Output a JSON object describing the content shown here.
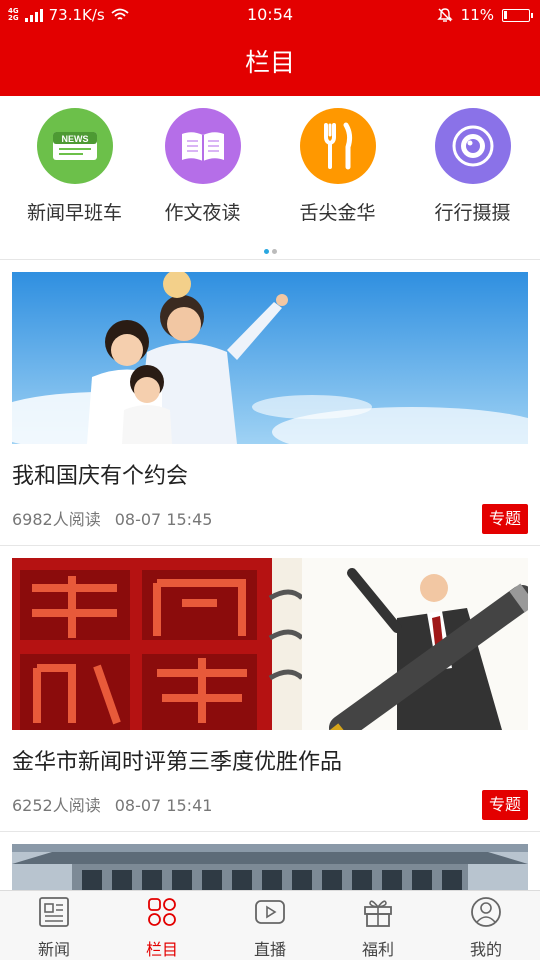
{
  "status_bar": {
    "network_top": "4G",
    "network_bottom": "2G",
    "speed": "73.1K/s",
    "time": "10:54",
    "battery": "11%",
    "battery_fraction": 0.11
  },
  "header": {
    "title": "栏目"
  },
  "columns": {
    "items": [
      {
        "label": "新闻早班车",
        "icon": "news-icon",
        "color": "#6cc04a"
      },
      {
        "label": "作文夜读",
        "icon": "book-icon",
        "color": "#b56ee8"
      },
      {
        "label": "舌尖金华",
        "icon": "fork-knife-icon",
        "color": "#ff9800"
      },
      {
        "label": "行行摄摄",
        "icon": "camera-lens-icon",
        "color": "#8a72e8"
      }
    ],
    "page_count": 2,
    "active_page": 1
  },
  "news": [
    {
      "title": "我和国庆有个约会",
      "reads": "6982人阅读",
      "time": "08-07 15:45",
      "badge": "专题"
    },
    {
      "title": "金华市新闻时评第三季度优胜作品",
      "reads": "6252人阅读",
      "time": "08-07 15:41",
      "badge": "专题"
    },
    {
      "title": "",
      "reads": "",
      "time": "",
      "badge": ""
    }
  ],
  "bottom_nav": {
    "items": [
      {
        "label": "新闻",
        "icon": "news-page-icon",
        "active": false
      },
      {
        "label": "栏目",
        "icon": "grid-icon",
        "active": true
      },
      {
        "label": "直播",
        "icon": "play-icon",
        "active": false
      },
      {
        "label": "福利",
        "icon": "gift-icon",
        "active": false
      },
      {
        "label": "我的",
        "icon": "profile-icon",
        "active": false
      }
    ]
  },
  "colors": {
    "brand_red": "#e30000",
    "indicator_blue": "#2aa7e0"
  }
}
